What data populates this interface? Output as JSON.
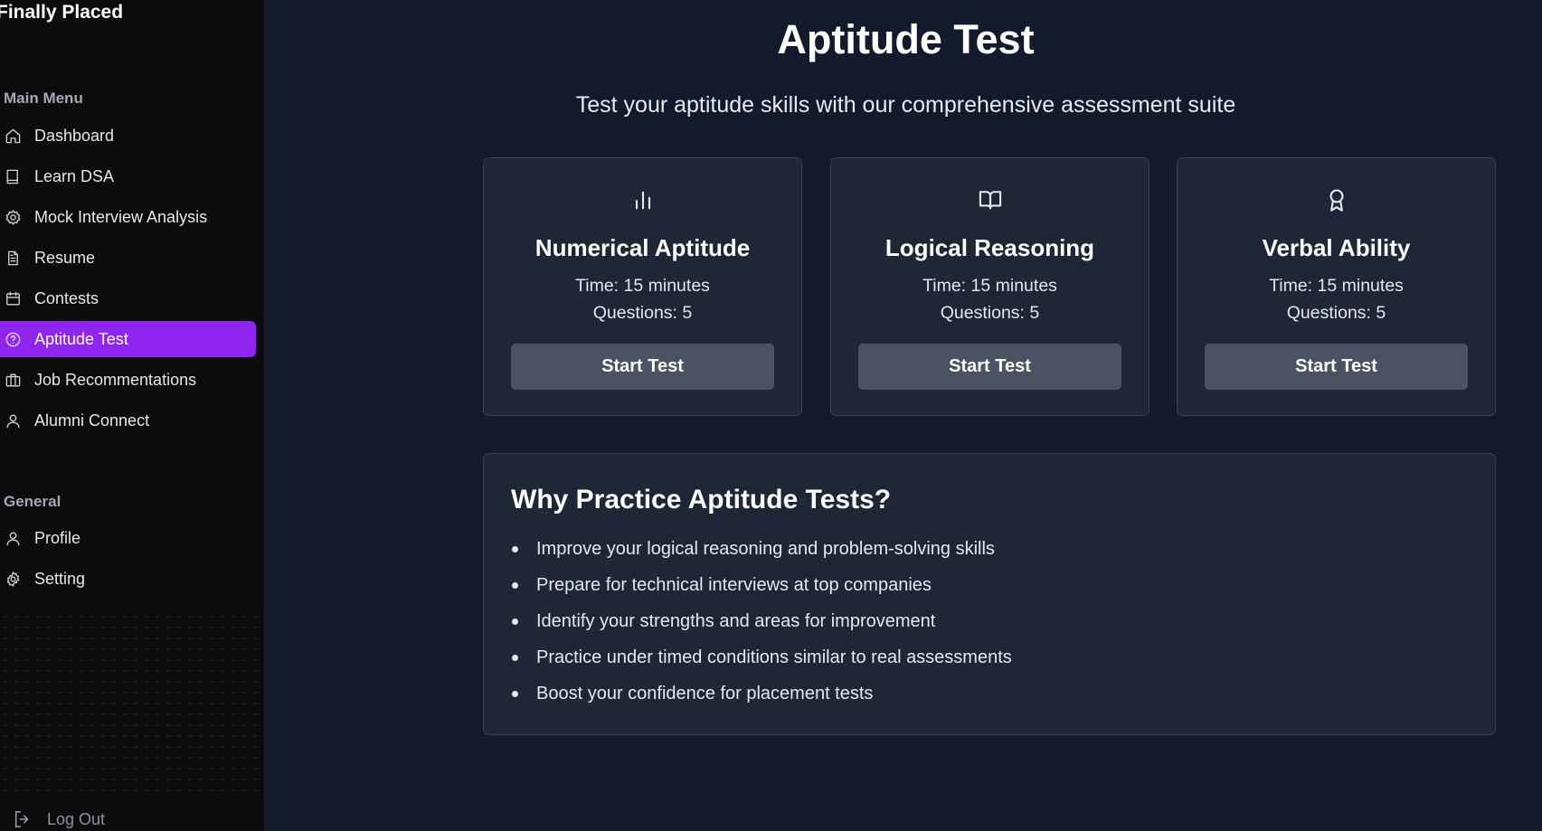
{
  "app": {
    "brand": "Finally Placed"
  },
  "sidebar": {
    "main_label": "Main Menu",
    "main_items": [
      {
        "label": "Dashboard",
        "icon": "home-icon"
      },
      {
        "label": "Learn DSA",
        "icon": "book-icon"
      },
      {
        "label": "Mock Interview Analysis",
        "icon": "settings-cog-icon"
      },
      {
        "label": "Resume",
        "icon": "file-text-icon"
      },
      {
        "label": "Contests",
        "icon": "calendar-icon"
      },
      {
        "label": "Aptitude Test",
        "icon": "help-circle-icon",
        "active": true
      },
      {
        "label": "Job Recommentations",
        "icon": "briefcase-icon"
      },
      {
        "label": "Alumni Connect",
        "icon": "user-icon"
      }
    ],
    "general_label": "General",
    "general_items": [
      {
        "label": "Profile",
        "icon": "user-icon"
      },
      {
        "label": "Setting",
        "icon": "gear-icon"
      }
    ],
    "logout_label": "Log Out",
    "active_color": "#9025ef"
  },
  "main": {
    "title": "Aptitude Test",
    "subtitle": "Test your aptitude skills with our comprehensive assessment suite",
    "cards": [
      {
        "title": "Numerical Aptitude",
        "time": "Time: 15 minutes",
        "questions": "Questions: 5",
        "button": "Start Test",
        "icon": "bar-chart-icon"
      },
      {
        "title": "Logical Reasoning",
        "time": "Time: 15 minutes",
        "questions": "Questions: 5",
        "button": "Start Test",
        "icon": "open-book-icon"
      },
      {
        "title": "Verbal Ability",
        "time": "Time: 15 minutes",
        "questions": "Questions: 5",
        "button": "Start Test",
        "icon": "award-icon"
      }
    ],
    "why": {
      "title": "Why Practice Aptitude Tests?",
      "points": [
        "Improve your logical reasoning and problem-solving skills",
        "Prepare for technical interviews at top companies",
        "Identify your strengths and areas for improvement",
        "Practice under timed conditions similar to real assessments",
        "Boost your confidence for placement tests"
      ]
    }
  }
}
